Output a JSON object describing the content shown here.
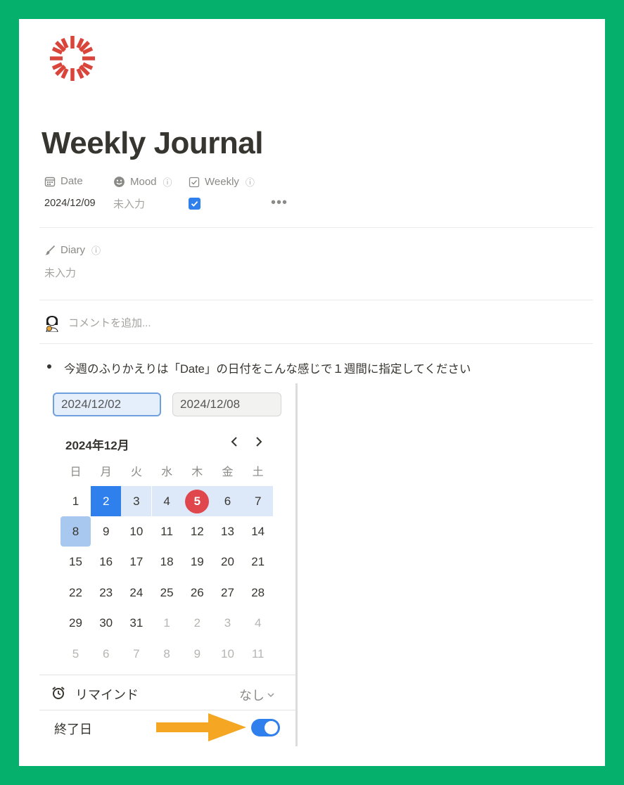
{
  "page": {
    "title": "Weekly Journal",
    "logo_icon": "sunburst-icon",
    "accent_color": "#d9453b"
  },
  "properties": {
    "date": {
      "label": "Date",
      "icon": "calendar-icon",
      "value": "2024/12/09"
    },
    "mood": {
      "label": "Mood",
      "icon": "smiley-icon",
      "info": "ⓘ",
      "value": "未入力"
    },
    "weekly": {
      "label": "Weekly",
      "icon": "checkbox-icon",
      "info": "ⓘ",
      "checked": true
    },
    "more": "•••",
    "diary": {
      "label": "Diary",
      "icon": "brush-icon",
      "info": "ⓘ",
      "value": "未入力"
    }
  },
  "comment": {
    "placeholder": "コメントを追加..."
  },
  "content": {
    "bullet": "今週のふりかえりは「Date」の日付をこんな感じで１週間に指定してください"
  },
  "date_picker": {
    "start_date": "2024/12/02",
    "end_date": "2024/12/08",
    "month_label": "2024年12月",
    "weekdays": [
      "日",
      "月",
      "火",
      "水",
      "木",
      "金",
      "土"
    ],
    "weeks": [
      [
        {
          "d": "1"
        },
        {
          "d": "2",
          "state": "start"
        },
        {
          "d": "3",
          "state": "inrange"
        },
        {
          "d": "4",
          "state": "inrange"
        },
        {
          "d": "5",
          "state": "today"
        },
        {
          "d": "6",
          "state": "inrange"
        },
        {
          "d": "7",
          "state": "inrange"
        }
      ],
      [
        {
          "d": "8",
          "state": "end"
        },
        {
          "d": "9"
        },
        {
          "d": "10"
        },
        {
          "d": "11"
        },
        {
          "d": "12"
        },
        {
          "d": "13"
        },
        {
          "d": "14"
        }
      ],
      [
        {
          "d": "15"
        },
        {
          "d": "16"
        },
        {
          "d": "17"
        },
        {
          "d": "18"
        },
        {
          "d": "19"
        },
        {
          "d": "20"
        },
        {
          "d": "21"
        }
      ],
      [
        {
          "d": "22"
        },
        {
          "d": "23"
        },
        {
          "d": "24"
        },
        {
          "d": "25"
        },
        {
          "d": "26"
        },
        {
          "d": "27"
        },
        {
          "d": "28"
        }
      ],
      [
        {
          "d": "29"
        },
        {
          "d": "30"
        },
        {
          "d": "31"
        },
        {
          "d": "1",
          "state": "other"
        },
        {
          "d": "2",
          "state": "other"
        },
        {
          "d": "3",
          "state": "other"
        },
        {
          "d": "4",
          "state": "other"
        }
      ],
      [
        {
          "d": "5",
          "state": "other"
        },
        {
          "d": "6",
          "state": "other"
        },
        {
          "d": "7",
          "state": "other"
        },
        {
          "d": "8",
          "state": "other"
        },
        {
          "d": "9",
          "state": "other"
        },
        {
          "d": "10",
          "state": "other"
        },
        {
          "d": "11",
          "state": "other"
        }
      ]
    ],
    "remind": {
      "label": "リマインド",
      "value": "なし",
      "icon": "alarm-clock-icon"
    },
    "end_date_toggle": {
      "label": "終了日",
      "on": true
    },
    "colors": {
      "selected": "#2f80ed",
      "range": "#dde9f8",
      "today": "#e0474c",
      "toggle": "#2f80ed"
    }
  },
  "annotation": {
    "arrow_color": "#f5a623"
  }
}
